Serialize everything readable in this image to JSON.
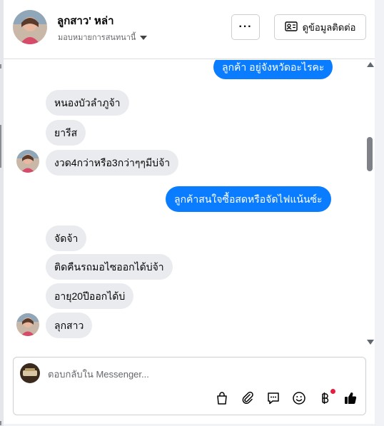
{
  "header": {
    "name": "ลูกสาว' หล่า",
    "subtitle": "มอบหมายการสนทนานี้",
    "more_label": "···",
    "contact_label": "ดูข้อมูลติดต่อ"
  },
  "messages": [
    {
      "direction": "out",
      "text": "ลูกค้า  อยู่จังหวัดอะไรคะ"
    },
    {
      "direction": "in",
      "text": "หนองบัวลำภูจ้า"
    },
    {
      "direction": "in",
      "text": "ยารีส"
    },
    {
      "direction": "in",
      "text": "งวด4กว่าหรือ3กว่าๆๆมีบ่จ้า"
    },
    {
      "direction": "out",
      "text": "ลูกค้าสนใจซื้อสดหรือจัดไฟแน้นซ์ะ"
    },
    {
      "direction": "in",
      "text": "จัดจ้า"
    },
    {
      "direction": "in",
      "text": "ติดคืนรถมอไซออกได้บ่จ้า"
    },
    {
      "direction": "in",
      "text": "อายุ20ปีออกได้บ่"
    },
    {
      "direction": "in",
      "text": "ลุกสาว"
    }
  ],
  "composer": {
    "placeholder": "ตอบกลับใน Messenger..."
  },
  "toolbar": {
    "icons": [
      "shopping-bag-icon",
      "paperclip-icon",
      "saved-reply-icon",
      "emoji-icon",
      "baht-payment-icon",
      "like-icon"
    ]
  },
  "colors": {
    "outgoing_bubble": "#0a7cff",
    "incoming_bubble": "#e9ebee",
    "notification_dot": "#e41e3f"
  }
}
